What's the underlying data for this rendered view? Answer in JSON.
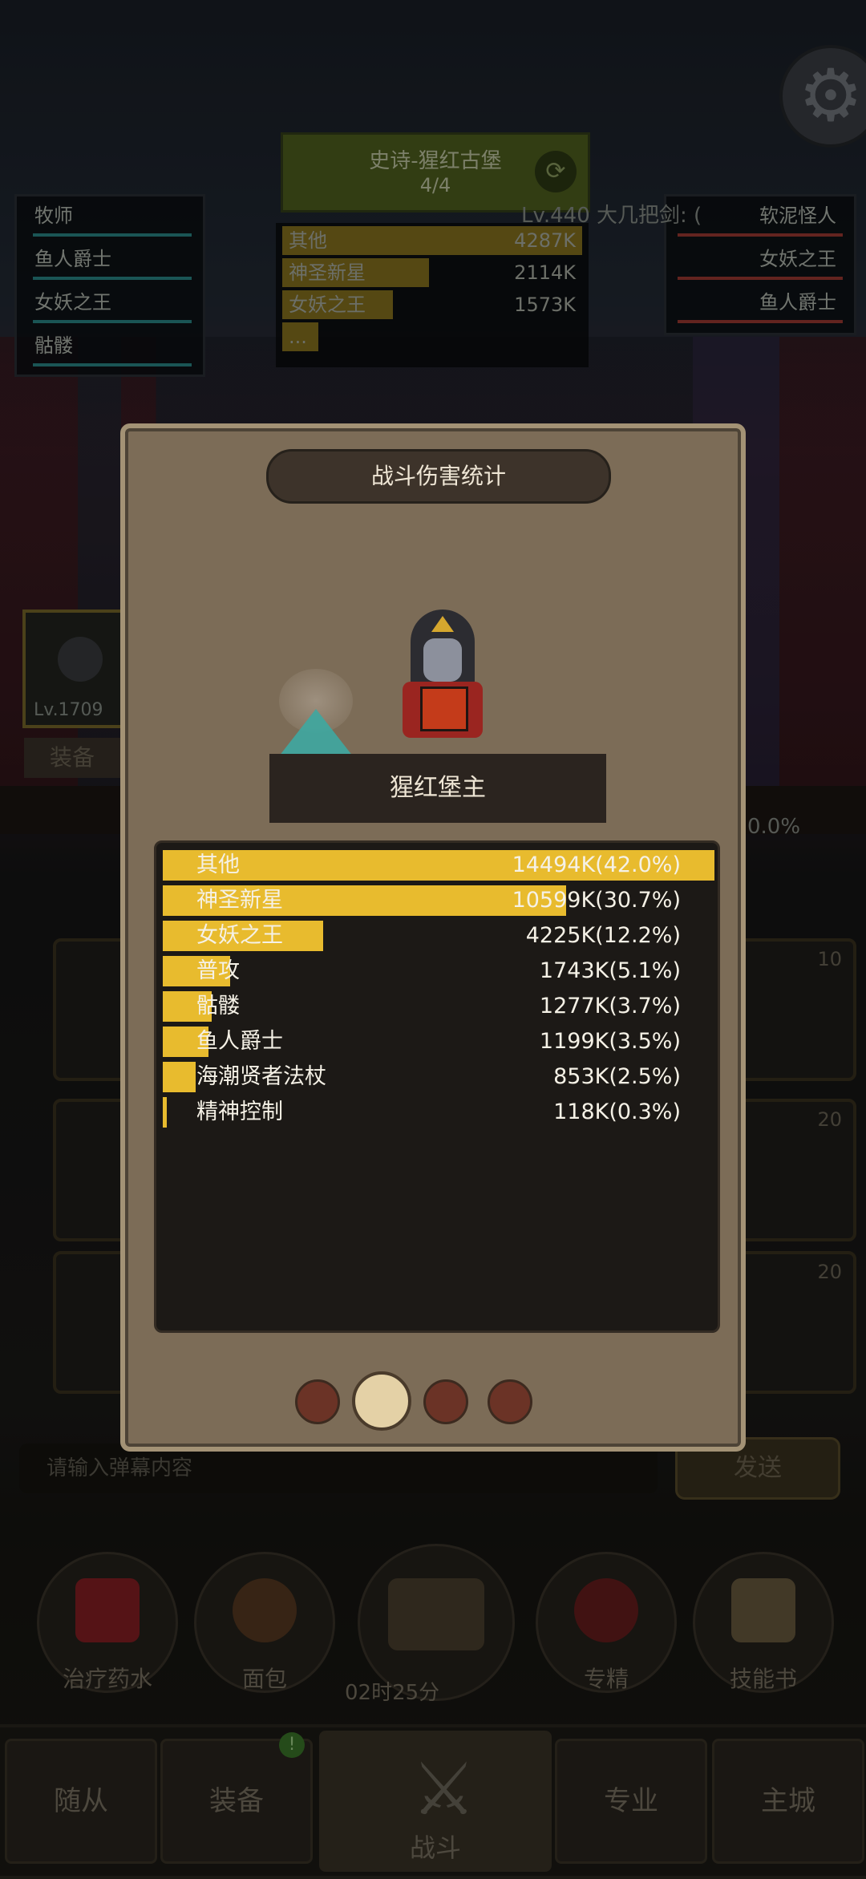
{
  "background": {
    "party": [
      "牧师",
      "鱼人爵士",
      "女妖之王",
      "骷髅"
    ],
    "enemies": [
      "软泥怪人",
      "女妖之王",
      "鱼人爵士"
    ],
    "stage": {
      "title": "史诗-猩红古堡",
      "progress": "4/4"
    },
    "level_text": "Lv.440 大几把剑: (",
    "mini_damage": [
      {
        "name": "其他",
        "value": "4287K",
        "fraction": 1.0
      },
      {
        "name": "神圣新星",
        "value": "2114K",
        "fraction": 0.49
      },
      {
        "name": "女妖之王",
        "value": "1573K",
        "fraction": 0.37
      },
      {
        "name": "...",
        "value": "",
        "fraction": 0.12
      }
    ],
    "hero_level": "Lv.1709",
    "equip_label": "装备",
    "percent_text": "0.0%",
    "chat": {
      "placeholder": "请输入弹幕内容",
      "send": "发送"
    },
    "shortcuts": [
      {
        "label": "治疗药水",
        "icon": "potion-icon",
        "color": "#b8232a"
      },
      {
        "label": "面包",
        "icon": "bread-icon",
        "color": "#7a4a2a"
      },
      {
        "label": "",
        "icon": "chest-icon",
        "color": "#6a5a3a"
      },
      {
        "label": "专精",
        "icon": "spec-icon",
        "color": "#8a2a2a"
      },
      {
        "label": "技能书",
        "icon": "skillbook-icon",
        "color": "#8b7a5a"
      }
    ],
    "timer": "02时25分",
    "nav": [
      "随从",
      "装备",
      "战斗",
      "专业",
      "主城"
    ],
    "nav_badge": "!",
    "slot_levels": [
      "10",
      "20",
      "20"
    ]
  },
  "modal": {
    "title": "战斗伤害统计",
    "boss_name": "猩红堡主",
    "damage_rows": [
      {
        "name": "其他",
        "value": "14494K(42.0%)",
        "percent": 42.0
      },
      {
        "name": "神圣新星",
        "value": "10599K(30.7%)",
        "percent": 30.7
      },
      {
        "name": "女妖之王",
        "value": "4225K(12.2%)",
        "percent": 12.2
      },
      {
        "name": "普攻",
        "value": "1743K(5.1%)",
        "percent": 5.1
      },
      {
        "name": "骷髅",
        "value": "1277K(3.7%)",
        "percent": 3.7
      },
      {
        "name": "鱼人爵士",
        "value": "1199K(3.5%)",
        "percent": 3.5
      },
      {
        "name": "海潮贤者法杖",
        "value": "853K(2.5%)",
        "percent": 2.5
      },
      {
        "name": "精神控制",
        "value": "118K(0.3%)",
        "percent": 0.3
      }
    ],
    "page_count": 4,
    "active_page": 1
  },
  "colors": {
    "bar": "#e8bb2e",
    "panel": "#1c1916",
    "modal": "#7c6c57"
  }
}
